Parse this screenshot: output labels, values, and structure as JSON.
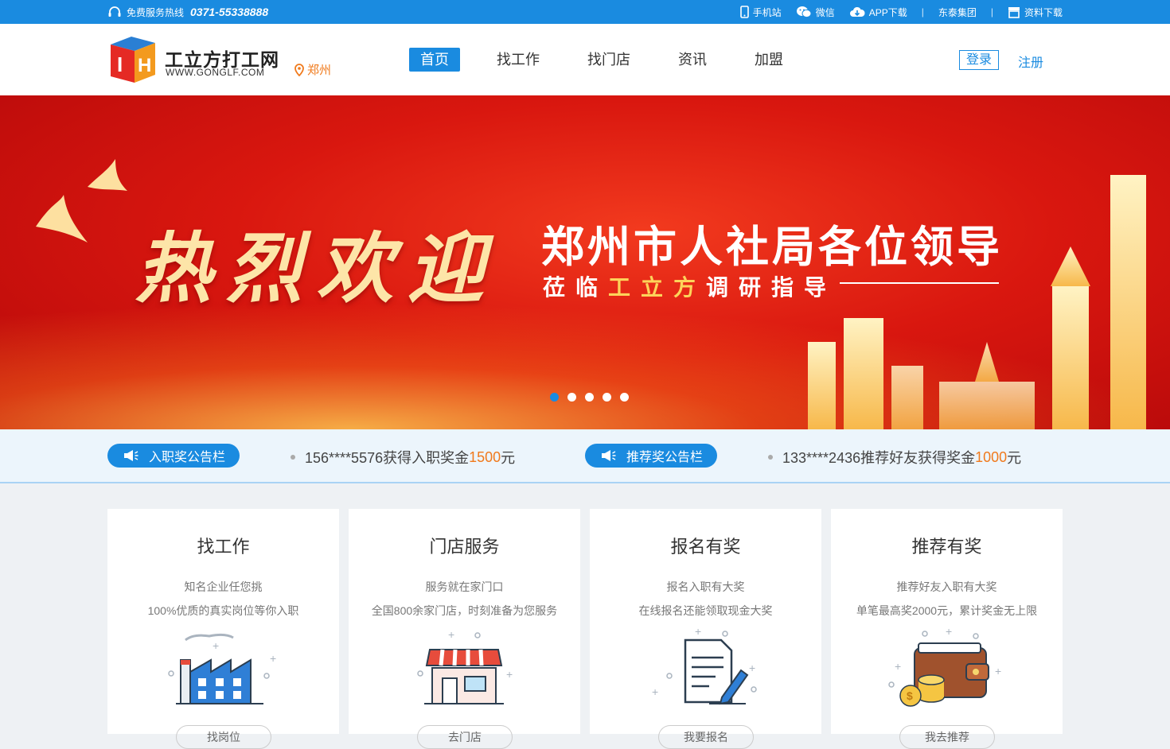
{
  "topbar": {
    "hotline_label": "免费服务热线",
    "hotline_number": "0371-55338888",
    "links": [
      "手机站",
      "微信",
      "APP下载",
      "东泰集团",
      "资料下载"
    ],
    "separator": "|"
  },
  "header": {
    "logo_name": "工立方打工网",
    "logo_url_text": "WWW.GONGLF.COM",
    "city": "郑州",
    "nav": [
      "首页",
      "找工作",
      "找门店",
      "资讯",
      "加盟"
    ],
    "login": "登录",
    "register": "注册"
  },
  "banner": {
    "welcome": "热烈欢迎",
    "title": "郑州市人社局各位领导",
    "sub_pre": "莅临",
    "sub_hl": "工立方",
    "sub_post": "调研指导",
    "slide_count": 5,
    "active_slide": 0
  },
  "notice": {
    "board1": "入职奖公告栏",
    "msg1": "156****5576获得入职奖金",
    "amt1": "1500",
    "unit1": "元",
    "board2": "推荐奖公告栏",
    "msg2": "133****2436推荐好友获得奖金",
    "amt2": "1000",
    "unit2": "元"
  },
  "cards": [
    {
      "title": "找工作",
      "line1": "知名企业任您挑",
      "line2": "100%优质的真实岗位等你入职",
      "icon": "factory-icon",
      "button": "找岗位"
    },
    {
      "title": "门店服务",
      "line1": "服务就在家门口",
      "line2": "全国800余家门店，时刻准备为您服务",
      "icon": "store-icon",
      "button": "去门店"
    },
    {
      "title": "报名有奖",
      "line1": "报名入职有大奖",
      "line2": "在线报名还能领取现金大奖",
      "icon": "document-pen-icon",
      "button": "我要报名"
    },
    {
      "title": "推荐有奖",
      "line1": "推荐好友入职有大奖",
      "line2": "单笔最高奖2000元，累计奖金无上限",
      "icon": "wallet-icon",
      "button": "我去推荐"
    }
  ],
  "colors": {
    "primary": "#1a8be0",
    "accent": "#f07a1c",
    "banner_red": "#d9170f",
    "gold": "#fdd35a"
  }
}
